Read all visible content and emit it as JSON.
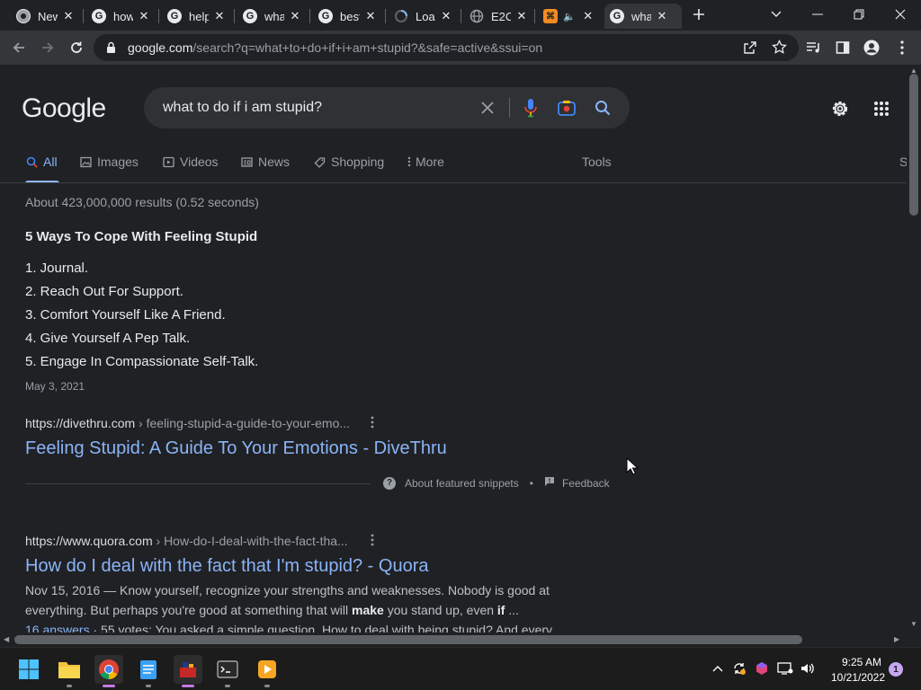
{
  "browser": {
    "tabs": [
      {
        "title": "New Tab",
        "favicon": "chrome-icon",
        "active": false
      },
      {
        "title": "how",
        "favicon": "google-icon",
        "active": false
      },
      {
        "title": "help",
        "favicon": "google-icon",
        "active": false
      },
      {
        "title": "what",
        "favicon": "google-icon",
        "active": false
      },
      {
        "title": "best",
        "favicon": "google-icon",
        "active": false
      },
      {
        "title": "Loading",
        "favicon": "loading-spinner-icon",
        "active": false
      },
      {
        "title": "E2C",
        "favicon": "globe-icon",
        "active": false
      },
      {
        "title": "",
        "favicon": "puzzle-site-icon",
        "active": false,
        "audio": true
      },
      {
        "title": "what",
        "favicon": "google-icon",
        "active": true
      }
    ],
    "url_host": "google.com",
    "url_path": "/search?q=what+to+do+if+i+am+stupid?&safe=active&ssui=on"
  },
  "google": {
    "logo_text": "Google",
    "query": "what to do if i am stupid?",
    "nav": {
      "all": "All",
      "images": "Images",
      "videos": "Videos",
      "news": "News",
      "shopping": "Shopping",
      "more": "More",
      "tools": "Tools",
      "safesearch_partial": "S"
    },
    "stats": "About 423,000,000 results (0.52 seconds)",
    "featured_snippet": {
      "title": "5 Ways To Cope With Feeling Stupid",
      "items": [
        "1. Journal.",
        "2. Reach Out For Support.",
        "3. Comfort Yourself Like A Friend.",
        "4. Give Yourself A Pep Talk.",
        "5. Engage In Compassionate Self-Talk."
      ],
      "date": "May 3, 2021",
      "cite_domain": "https://divethru.com",
      "cite_path": " › feeling-stupid-a-guide-to-your-emo...",
      "link_title": "Feeling Stupid: A Guide To Your Emotions - DiveThru",
      "about": "About featured snippets",
      "dot": "•",
      "feedback": "Feedback"
    },
    "result2": {
      "cite_domain": "https://www.quora.com",
      "cite_path": " › How-do-I-deal-with-the-fact-tha...",
      "title": "How do I deal with the fact that I'm stupid? - Quora",
      "line1": "Nov 15, 2016 — Know yourself, recognize your strengths and weaknesses. Nobody is good at",
      "line2_a": "everything. But perhaps you're good at something that will ",
      "line2_b": "make",
      "line2_c": " you stand up, even ",
      "line2_d": "if",
      "line2_e": " ...",
      "line3_a": "16 answers",
      "line3_b": " · 55 votes: You asked a simple question. How to deal with being stupid? And every"
    }
  },
  "taskbar": {
    "time": "9:25 AM",
    "date": "10/21/2022",
    "notifications": "1"
  },
  "colors": {
    "accent_link": "#8ab4f8",
    "background": "#202124",
    "chrome_toolbar": "#35363a"
  }
}
